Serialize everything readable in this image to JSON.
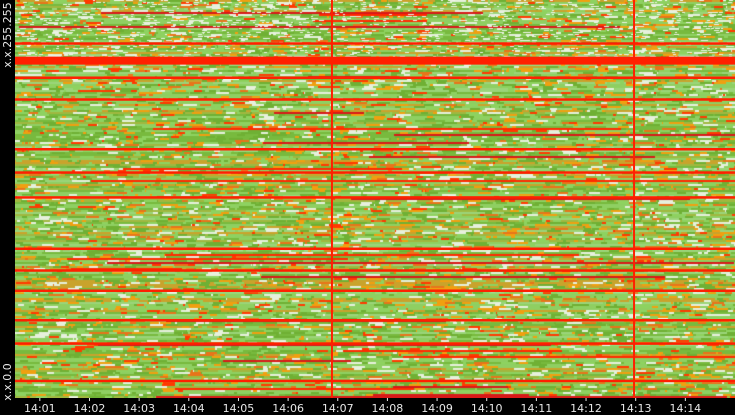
{
  "chart_data": {
    "type": "heatmap",
    "title": "",
    "xlabel": "",
    "ylabel": "",
    "x_tick_labels": [
      "14:01",
      "14:02",
      "14:03",
      "14:04",
      "14:05",
      "14:06",
      "14:07",
      "14:08",
      "14:09",
      "14:10",
      "14:11",
      "14:12",
      "14:13",
      "14:14"
    ],
    "x_range": [
      "14:00:30",
      "14:15:00"
    ],
    "y_tick_labels": [
      "x.x.255.255",
      "x.x.0.0"
    ],
    "y_range": [
      "x.x.0.0",
      "x.x.255.255"
    ],
    "color_scale": [
      "#ffffff",
      "#8fd16a",
      "#7bbd3c",
      "#cfa22a",
      "#f0a010",
      "#ff3a00",
      "#e00000"
    ],
    "colors": {
      "background": "#000000",
      "base_green": "#7fc24a",
      "hot_red": "#ff2000",
      "tick_text": "#e8e8e8"
    },
    "grid": false,
    "legend": "none",
    "hot_rows_y": [
      "x.x.228.0",
      "x.x.217.0",
      "x.x.206.0",
      "x.x.192.0",
      "x.x.160.0",
      "x.x.145.0",
      "x.x.129.0",
      "x.x.96.0",
      "x.x.82.0",
      "x.x.69.0",
      "x.x.50.0",
      "x.x.35.0",
      "x.x.11.0"
    ],
    "hot_columns_x": [
      "14:06:53",
      "14:12:58"
    ]
  }
}
